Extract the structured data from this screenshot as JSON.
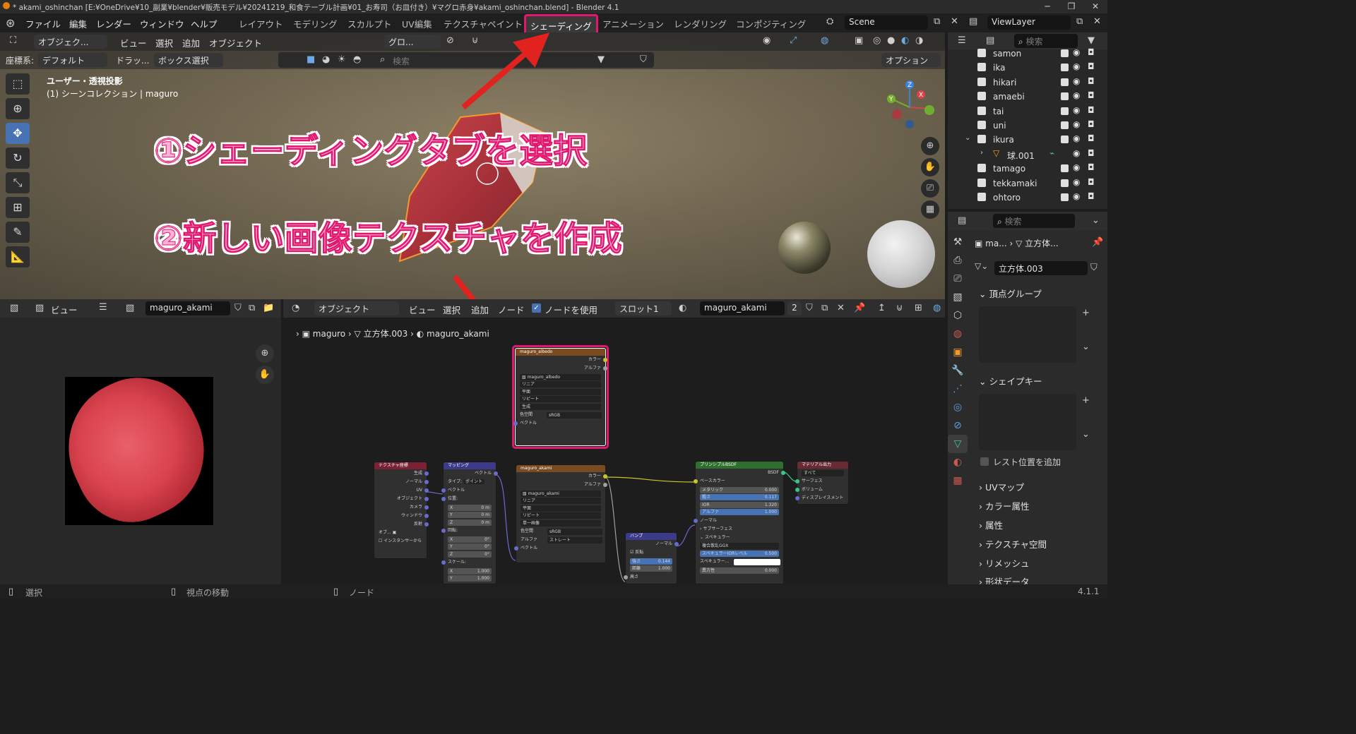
{
  "window": {
    "title": "* akami_oshinchan [E:¥OneDrive¥10_副業¥blender¥販売モデル¥20241219_和食テーブル計画¥01_お寿司（お皿付き）¥マグロ赤身¥akami_oshinchan.blend] - Blender 4.1"
  },
  "menu": [
    "ファイル",
    "編集",
    "レンダー",
    "ウィンドウ",
    "ヘルプ"
  ],
  "workspaces": [
    "レイアウト",
    "モデリング",
    "スカルプト",
    "UV編集",
    "テクスチャペイント",
    "シェーディング",
    "アニメーション",
    "レンダリング",
    "コンポジティング"
  ],
  "active_workspace": "シェーディング",
  "scene": "Scene",
  "view_layer": "ViewLayer",
  "viewport": {
    "mode": "オブジェク...",
    "menus": [
      "ビュー",
      "選択",
      "追加",
      "オブジェクト"
    ],
    "transform": "グロ...",
    "coord_label": "座標系:",
    "coord_value": "デフォルト",
    "drag_label": "ドラッ...",
    "select_mode": "ボックス選択",
    "search_placeholder": "検索",
    "options": "オプション",
    "view_name": "ユーザー・透視投影",
    "collection_info": "(1) シーンコレクション | maguro",
    "gizmo_axes": [
      "X",
      "Y",
      "Z"
    ]
  },
  "annotations": {
    "step1": "①シェーディングタブを選択",
    "step2": "②新しい画像テクスチャを作成"
  },
  "outliner": {
    "search_placeholder": "検索",
    "items": [
      {
        "name": "samon"
      },
      {
        "name": "ika"
      },
      {
        "name": "hikari"
      },
      {
        "name": "amaebi"
      },
      {
        "name": "tai"
      },
      {
        "name": "uni"
      },
      {
        "name": "ikura"
      },
      {
        "name": "球.001"
      },
      {
        "name": "tamago"
      },
      {
        "name": "tekkamaki"
      },
      {
        "name": "ohtoro"
      }
    ]
  },
  "properties": {
    "search_placeholder": "検索",
    "breadcrumb_object": "ma...",
    "breadcrumb_mesh": "立方体...",
    "mesh_name": "立方体.003",
    "panels": {
      "vertex_groups": "頂点グループ",
      "shape_keys": "シェイプキー",
      "add_rest_position": "レスト位置を追加",
      "uv_maps": "UVマップ",
      "color_attributes": "カラー属性",
      "attributes": "属性",
      "texture_space": "テクスチャ空間",
      "remesh": "リメッシュ",
      "shape_data": "形状データ"
    }
  },
  "image_editor": {
    "view": "ビュー",
    "image_name": "maguro_akami"
  },
  "node_editor": {
    "mode": "オブジェクト",
    "menus": [
      "ビュー",
      "選択",
      "追加",
      "ノード"
    ],
    "use_nodes": "ノードを使用",
    "slot": "スロット1",
    "material": "maguro_akami",
    "users": "2",
    "breadcrumb": [
      "maguro",
      "立方体.003",
      "maguro_akami"
    ],
    "albedo_node": {
      "title": "maguro_albedo",
      "outputs": [
        "カラー",
        "アルファ"
      ],
      "image": "maguro_albedo",
      "options": [
        "リニア",
        "平面",
        "リピート",
        "生成"
      ],
      "colorspace_label": "色空間",
      "colorspace": "sRGB",
      "vector": "ベクトル"
    },
    "texcoord_node": {
      "title": "テクスチャ座標",
      "outputs": [
        "生成",
        "ノーマル",
        "UV",
        "オブジェクト",
        "カメラ",
        "ウィンドウ",
        "反射"
      ],
      "object_label": "オブ...",
      "instancer": "インスタンサーから"
    },
    "mapping_node": {
      "title": "マッピング",
      "output": "ベクトル",
      "type_label": "タイプ:",
      "type_value": "ポイント",
      "vector": "ベクトル",
      "location": "位置:",
      "loc": [
        [
          "X",
          "0 m"
        ],
        [
          "Y",
          "0 m"
        ],
        [
          "Z",
          "0 m"
        ]
      ],
      "rotation": "回転:",
      "rot": [
        [
          "X",
          "0°"
        ],
        [
          "Y",
          "0°"
        ],
        [
          "Z",
          "0°"
        ]
      ],
      "scale": "スケール:",
      "scl": [
        [
          "X",
          "1.000"
        ],
        [
          "Y",
          "1.000"
        ]
      ]
    },
    "akami_node": {
      "title": "maguro_akami",
      "outputs": [
        "カラー",
        "アルファ"
      ],
      "image": "maguro_akami",
      "options": [
        "リニア",
        "平面",
        "リピート",
        "単一画像"
      ],
      "colorspace_label": "色空間",
      "colorspace": "sRGB",
      "alpha_label": "アルファ",
      "alpha": "ストレート",
      "vector": "ベクトル"
    },
    "bump_node": {
      "title": "バンプ",
      "output": "ノーマル",
      "invert": "反転",
      "strength_label": "強さ",
      "strength": "0.144",
      "distance_label": "距離",
      "distance": "1.000",
      "height": "高さ"
    },
    "bsdf_node": {
      "title": "プリンシプルBSDF",
      "output": "BSDF",
      "base_color": "ベースカラー",
      "metallic_label": "メタリック",
      "metallic": "0.000",
      "roughness_label": "粗さ",
      "roughness": "0.117",
      "ior_label": "IOR",
      "ior": "1.320",
      "alpha_label": "アルファ",
      "alpha": "1.000",
      "normal": "ノーマル",
      "subsurface": "サブサーフェス",
      "specular": "スペキュラー",
      "distribution": "複合散乱GGX",
      "spec_ior_label": "スペキュラーIORレベル",
      "spec_ior": "0.500",
      "spec_tint_label": "スペキュラー...",
      "anisotropic_label": "異方性",
      "anisotropic": "0.000"
    },
    "output_node": {
      "title": "マテリアル出力",
      "target": "すべて",
      "inputs": [
        "サーフェス",
        "ボリューム",
        "ディスプレイスメント"
      ]
    }
  },
  "status": {
    "select": "選択",
    "rotate_view": "視点の移動",
    "node": "ノード",
    "version": "4.1.1"
  },
  "colors": {
    "highlight": "#e2186f",
    "accent_blue": "#4772b3",
    "texture_node": "#7a4a20",
    "shader_node": "#2e6e2e",
    "output_node": "#6a2a35",
    "vector_node": "#3b3b8a",
    "input_node": "#7a2233"
  }
}
